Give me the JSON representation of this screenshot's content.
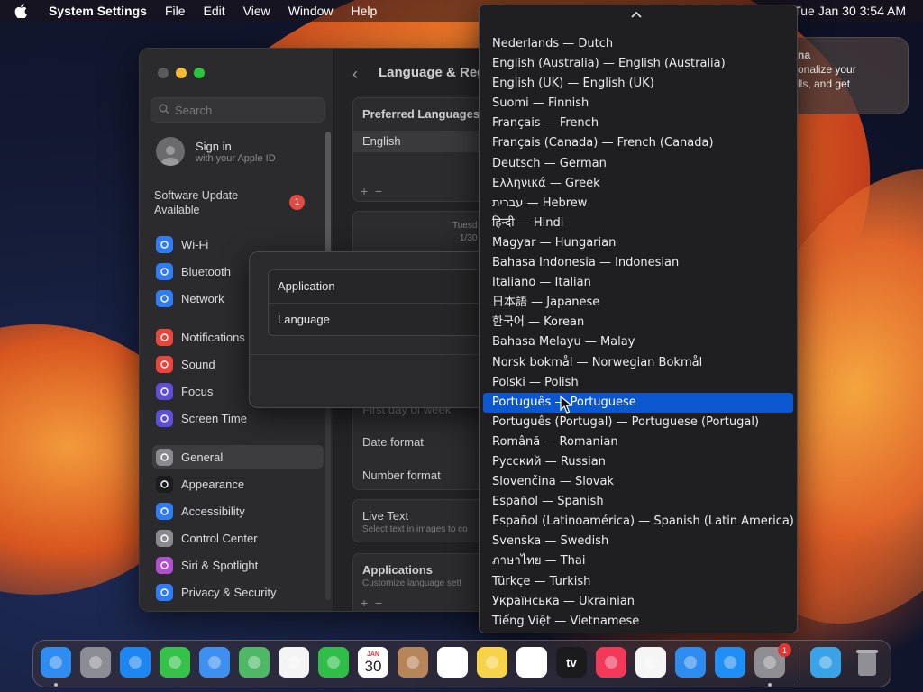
{
  "menubar": {
    "app_name": "System Settings",
    "items": [
      "File",
      "Edit",
      "View",
      "Window",
      "Help"
    ],
    "clock": "Tue Jan 30  3:54 AM"
  },
  "window": {
    "search_placeholder": "Search",
    "signin_title": "Sign in",
    "signin_sub": "with your Apple ID",
    "software_update": "Software Update Available",
    "update_badge": "1",
    "sidebar_items": [
      {
        "label": "Wi-Fi",
        "color": "#2f7cf6",
        "icon": "wifi-icon"
      },
      {
        "label": "Bluetooth",
        "color": "#2f7cf6",
        "icon": "bluetooth-icon"
      },
      {
        "label": "Network",
        "color": "#2f7cf6",
        "icon": "globe-icon"
      },
      {
        "label": "Notifications",
        "color": "#e8453c",
        "icon": "bell-icon"
      },
      {
        "label": "Sound",
        "color": "#e8453c",
        "icon": "speaker-icon"
      },
      {
        "label": "Focus",
        "color": "#5d4ed6",
        "icon": "moon-icon"
      },
      {
        "label": "Screen Time",
        "color": "#5d4ed6",
        "icon": "hourglass-icon"
      },
      {
        "label": "General",
        "color": "#8a8a8e",
        "icon": "gear-icon"
      },
      {
        "label": "Appearance",
        "color": "#1c1c1e",
        "icon": "appearance-icon"
      },
      {
        "label": "Accessibility",
        "color": "#2f7cf6",
        "icon": "accessibility-icon"
      },
      {
        "label": "Control Center",
        "color": "#8a8a8e",
        "icon": "control-center-icon"
      },
      {
        "label": "Siri & Spotlight",
        "color": "#b04fd0",
        "icon": "siri-icon"
      },
      {
        "label": "Privacy & Security",
        "color": "#2f7cf6",
        "icon": "hand-icon"
      }
    ],
    "main_title": "Language & Reg",
    "preferred_languages": "Preferred Languages",
    "pref_english": "English",
    "region_date1": "Tuesd",
    "region_date2": "1/30",
    "first_day": "First day of week",
    "date_format": "Date format",
    "number_format": "Number format",
    "live_text": "Live Text",
    "live_text_sub": "Select text in images to co",
    "applications": "Applications",
    "applications_sub": "Customize language sett"
  },
  "sheet": {
    "application_label": "Application",
    "language_label": "Language"
  },
  "notification": {
    "line1": "na",
    "line2": "onalize your",
    "line3": "lls, and get"
  },
  "dropdown": {
    "selected_index": 17,
    "items": [
      "Nederlands — Dutch",
      "English (Australia) — English (Australia)",
      "English (UK) — English (UK)",
      "Suomi — Finnish",
      "Français — French",
      "Français (Canada) — French (Canada)",
      "Deutsch — German",
      "Ελληνικά — Greek",
      "עברית — Hebrew",
      "हिन्दी — Hindi",
      "Magyar — Hungarian",
      "Bahasa Indonesia — Indonesian",
      "Italiano — Italian",
      "日本語 — Japanese",
      "한국어 — Korean",
      "Bahasa Melayu — Malay",
      "Norsk bokmål — Norwegian Bokmål",
      "Polski — Polish",
      "Português — Portuguese",
      "Português (Portugal) — Portuguese (Portugal)",
      "Română — Romanian",
      "Русский — Russian",
      "Slovenčina — Slovak",
      "Español — Spanish",
      "Español (Latinoamérica) — Spanish (Latin America)",
      "Svenska — Swedish",
      "ภาษาไทย — Thai",
      "Türkçe — Turkish",
      "Українська — Ukrainian",
      "Tiếng Việt — Vietnamese"
    ]
  },
  "dock": {
    "calendar_month": "JAN",
    "calendar_day": "30",
    "tv_label": "tv",
    "settings_badge": "1",
    "apps": [
      {
        "name": "finder-icon",
        "color": "#2f8cf0"
      },
      {
        "name": "launchpad-icon",
        "color": "#8c8c94"
      },
      {
        "name": "safari-icon",
        "color": "#1e86f0"
      },
      {
        "name": "messages-icon",
        "color": "#36c24a"
      },
      {
        "name": "mail-icon",
        "color": "#3d8ff0"
      },
      {
        "name": "maps-icon",
        "color": "#4fb866"
      },
      {
        "name": "photos-icon",
        "color": "#f4f4f4"
      },
      {
        "name": "facetime-icon",
        "color": "#2fbf48"
      },
      {
        "name": "calendar-icon",
        "color": "#ffffff"
      },
      {
        "name": "contacts-icon",
        "color": "#b6865a"
      },
      {
        "name": "reminders-icon",
        "color": "#ffffff"
      },
      {
        "name": "notes-icon",
        "color": "#f6d34a"
      },
      {
        "name": "freeform-icon",
        "color": "#ffffff"
      },
      {
        "name": "tv-icon",
        "color": "#1b1b1d"
      },
      {
        "name": "music-icon",
        "color": "#f2395a"
      },
      {
        "name": "news-icon",
        "color": "#f5f5f5"
      },
      {
        "name": "keynote-icon",
        "color": "#2d8cf0"
      },
      {
        "name": "app-store-icon",
        "color": "#1f8ef5"
      },
      {
        "name": "system-settings-icon",
        "color": "#8e8e93"
      },
      {
        "name": "downloads-folder-icon",
        "color": "#3aa3e8"
      },
      {
        "name": "trash-icon",
        "color": "#9a9a9e"
      }
    ]
  }
}
